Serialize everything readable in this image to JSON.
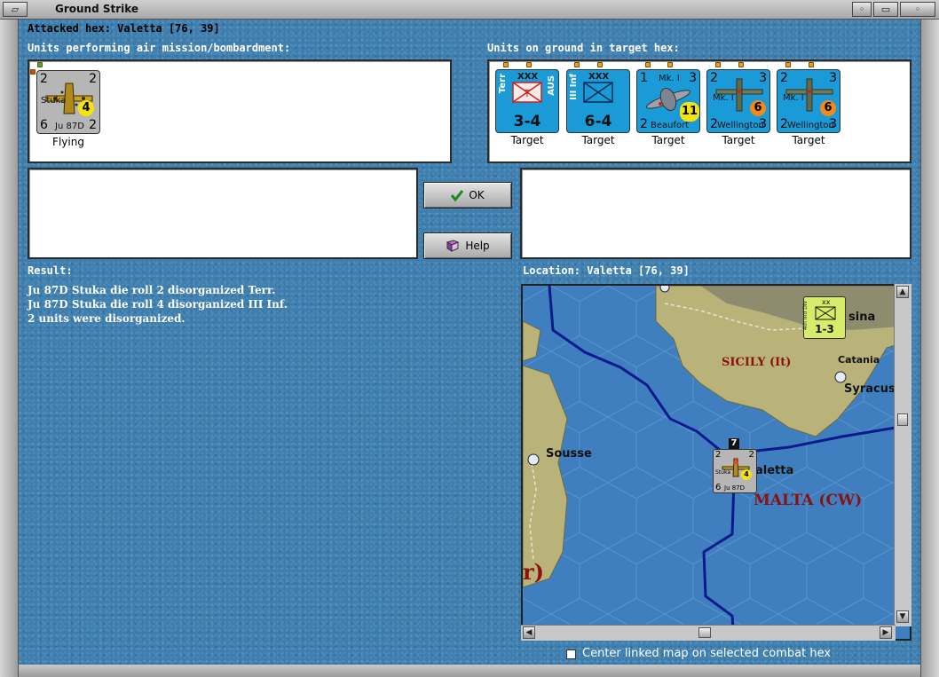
{
  "window": {
    "title": "Ground Strike"
  },
  "header": {
    "attacked_hex": "Attacked hex: Valetta  [76, 39]"
  },
  "air_units": {
    "label": "Units performing air mission/bombardment:",
    "items": [
      {
        "left_top": "2",
        "right_top": "2",
        "left_bottom": "6",
        "right_bottom": "2",
        "name": "Ju 87D",
        "type": "Stuka",
        "badge": "4",
        "status": "Flying"
      }
    ]
  },
  "ground_units": {
    "label": "Units on ground in target hex:",
    "items": [
      {
        "side_left": "Terr",
        "size": "XXX",
        "side_right": "AUS",
        "strength": "3-4",
        "caption": "Target"
      },
      {
        "side_left": "III Inf",
        "size": "XXX",
        "strength": "6-4",
        "caption": "Target"
      },
      {
        "left_top": "1",
        "model": "Mk. I",
        "right_top": "3",
        "left_bottom": "2",
        "name": "Beaufort",
        "badge": "11",
        "caption": "Target"
      },
      {
        "left_top": "2",
        "model": "Mk. I",
        "right_top": "3",
        "left_bottom": "2",
        "name": "Wellington",
        "right_bottom": "3",
        "badge": "6",
        "caption": "Target"
      },
      {
        "left_top": "2",
        "model": "Mk. I",
        "right_top": "3",
        "left_bottom": "2",
        "name": "Wellington",
        "right_bottom": "3",
        "badge": "6",
        "caption": "Target"
      }
    ]
  },
  "buttons": {
    "ok": "OK",
    "help": "Help"
  },
  "result": {
    "label": "Result:",
    "lines": [
      "Ju 87D Stuka die roll 2 disorganized Terr.",
      "Ju 87D Stuka die roll 4 disorganized III Inf.",
      "2 units were disorganized."
    ]
  },
  "location": {
    "label": "Location:  Valetta  [76, 39]"
  },
  "map": {
    "labels": {
      "sicily": "SICILY (It)",
      "catania": "Catania",
      "syracuse": "Syracus",
      "messina": "sina",
      "sousse": "Sousse",
      "valetta": "aletta",
      "malta": "MALTA (CW)",
      "partial": "r)"
    },
    "corps_counter": {
      "size": "xx",
      "strength": "1-3",
      "side": "4th Ind Div"
    },
    "stack_counter": {
      "left_top": "2",
      "right_top": "2",
      "left_bottom": "6",
      "right_bottom": "2",
      "name": "Ju 87D",
      "type": "Stuka",
      "badge": "4",
      "stack_count": "7"
    },
    "colors": {
      "sea": "#3f7fc0",
      "land": "#b9b37a",
      "border": "#0a1a8c",
      "label_red": "#8b1010"
    }
  },
  "footer": {
    "center_map_label": "Center linked map on selected combat hex"
  },
  "icons": [
    "check-icon",
    "help-book-icon",
    "window-menu-icon",
    "minimize-icon",
    "maximize-icon",
    "close-icon"
  ]
}
